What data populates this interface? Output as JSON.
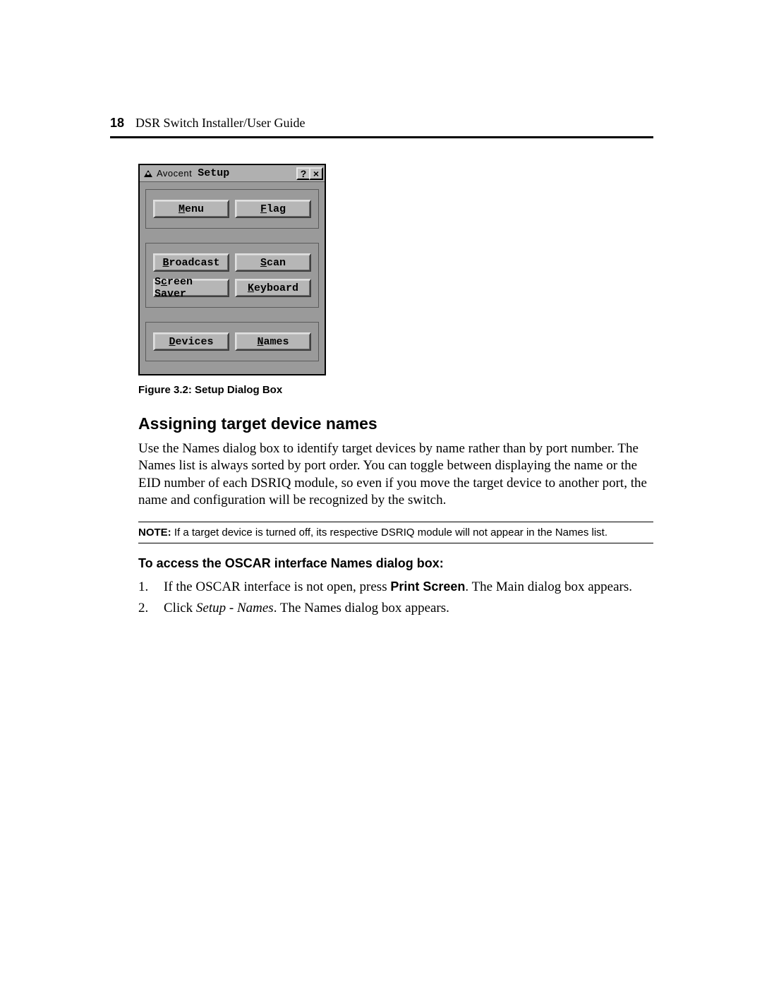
{
  "header": {
    "page_number": "18",
    "doc_title": "DSR Switch Installer/User Guide"
  },
  "dialog": {
    "brand": "Avocent",
    "title": "Setup",
    "help_symbol": "?",
    "close_symbol": "×",
    "groups": [
      {
        "buttons": [
          {
            "pre": "",
            "hot": "M",
            "post": "enu"
          },
          {
            "pre": "",
            "hot": "F",
            "post": "lag"
          }
        ]
      },
      {
        "buttons": [
          {
            "pre": "",
            "hot": "B",
            "post": "roadcast"
          },
          {
            "pre": "",
            "hot": "S",
            "post": "can"
          },
          {
            "pre": "S",
            "hot": "c",
            "post": "reen Saver"
          },
          {
            "pre": "",
            "hot": "K",
            "post": "eyboard"
          }
        ]
      },
      {
        "buttons": [
          {
            "pre": "",
            "hot": "D",
            "post": "evices"
          },
          {
            "pre": "",
            "hot": "N",
            "post": "ames"
          }
        ]
      }
    ]
  },
  "figure_caption": "Figure 3.2: Setup Dialog Box",
  "section_heading": "Assigning target device names",
  "paragraph": "Use the Names dialog box to identify target devices by name rather than by port number. The Names list is always sorted by port order. You can toggle between displaying the name or the EID number of each DSRIQ module, so even if you move the target device to another port, the name and configuration will be recognized by the switch.",
  "note": {
    "label": "NOTE:",
    "text": " If a target device is turned off, its respective DSRIQ module will not appear in the Names list."
  },
  "subheading": "To access the OSCAR interface Names dialog box:",
  "steps": [
    {
      "n": "1.",
      "before": "If the OSCAR interface is not open, press ",
      "bold": "Print Screen",
      "after": ". The Main dialog box appears."
    },
    {
      "n": "2.",
      "before": "Click ",
      "ital": "Setup - Names",
      "after": ". The Names dialog box appears."
    }
  ]
}
